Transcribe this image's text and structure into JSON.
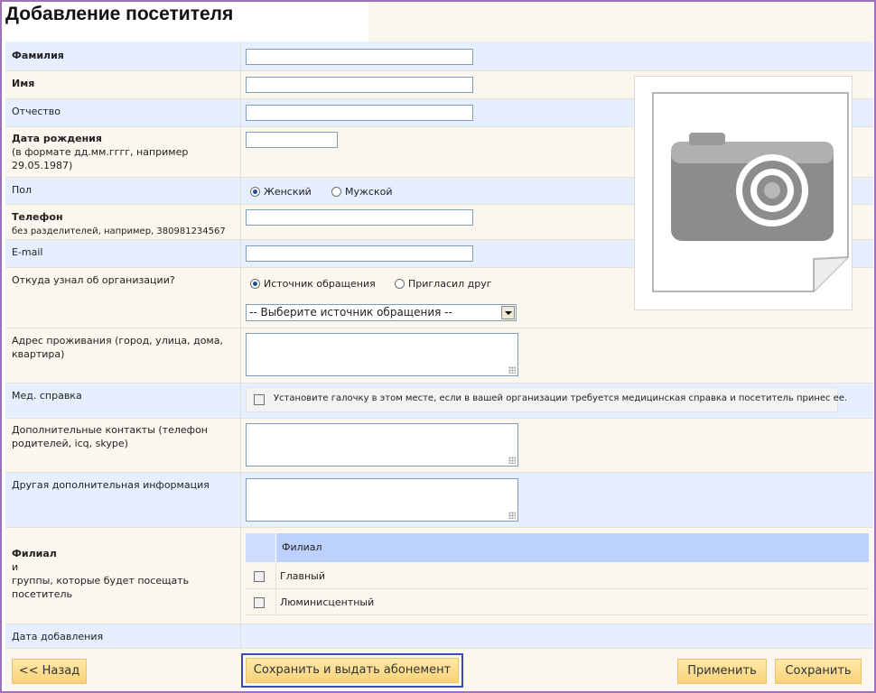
{
  "page_title": "Добавление посетителя",
  "fields": {
    "lastname": {
      "label": "Фамилия",
      "value": ""
    },
    "firstname": {
      "label": "Имя",
      "value": ""
    },
    "patronymic": {
      "label": "Отчество",
      "value": ""
    },
    "birthdate": {
      "label": "Дата рождения",
      "hint": "(в формате дд.мм.гггг, например 29.05.1987)",
      "value": ""
    },
    "gender": {
      "label": "Пол",
      "options": [
        "Женский",
        "Мужской"
      ],
      "selected": "Женский"
    },
    "phone": {
      "label": "Телефон",
      "hint": "без разделителей, например, 380981234567",
      "value": ""
    },
    "email": {
      "label": "E-mail",
      "value": ""
    },
    "referral": {
      "label": "Откуда узнал об организации?",
      "options": [
        "Источник обращения",
        "Пригласил друг"
      ],
      "selected": "Источник обращения",
      "source_select": "-- Выберите источник обращения --"
    },
    "address": {
      "label": "Адрес проживания (город, улица, дома, квартира)",
      "value": ""
    },
    "medical": {
      "label": "Мед. справка",
      "checkbox_text": "Установите галочку в этом месте, если в вашей организации требуется медицинская справка и посетитель принес ее."
    },
    "extra_contacts": {
      "label": "Дополнительные контакты (телефон родителей, icq, skype)",
      "value": ""
    },
    "other_info": {
      "label": "Другая дополнительная информация",
      "value": ""
    },
    "branch": {
      "label_bold": "Филиал",
      "label_rest": "и\nгруппы, которые будет посещать посетитель",
      "column_header": "Филиал",
      "rows": [
        "Главный",
        "Люминисцентный"
      ]
    },
    "added_date": {
      "label": "Дата добавления"
    }
  },
  "buttons": {
    "back": "<< Назад",
    "save_issue": "Сохранить и выдать абонемент",
    "apply": "Применить",
    "save": "Сохранить"
  },
  "photo_icon": "camera-icon"
}
